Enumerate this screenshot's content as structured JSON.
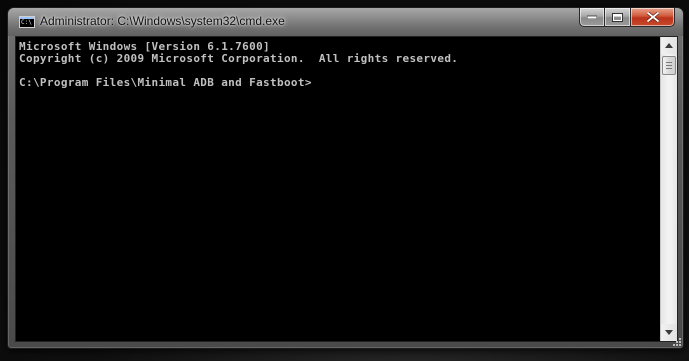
{
  "window": {
    "title": "Administrator: C:\\Windows\\system32\\cmd.exe",
    "icon_name": "cmd-icon",
    "icon_text": "C:\\"
  },
  "caption_buttons": {
    "minimize_icon": "minimize-icon",
    "maximize_icon": "maximize-icon",
    "close_icon": "close-icon"
  },
  "console": {
    "lines": [
      "Microsoft Windows [Version 6.1.7600]",
      "Copyright (c) 2009 Microsoft Corporation.  All rights reserved.",
      "",
      "C:\\Program Files\\Minimal ADB and Fastboot>"
    ]
  },
  "scrollbar": {
    "up_icon": "scroll-up-arrow-icon",
    "down_icon": "scroll-down-arrow-icon"
  },
  "colors": {
    "console_background": "#000000",
    "console_text": "#c0c0c0",
    "close_button": "#c8462a"
  }
}
